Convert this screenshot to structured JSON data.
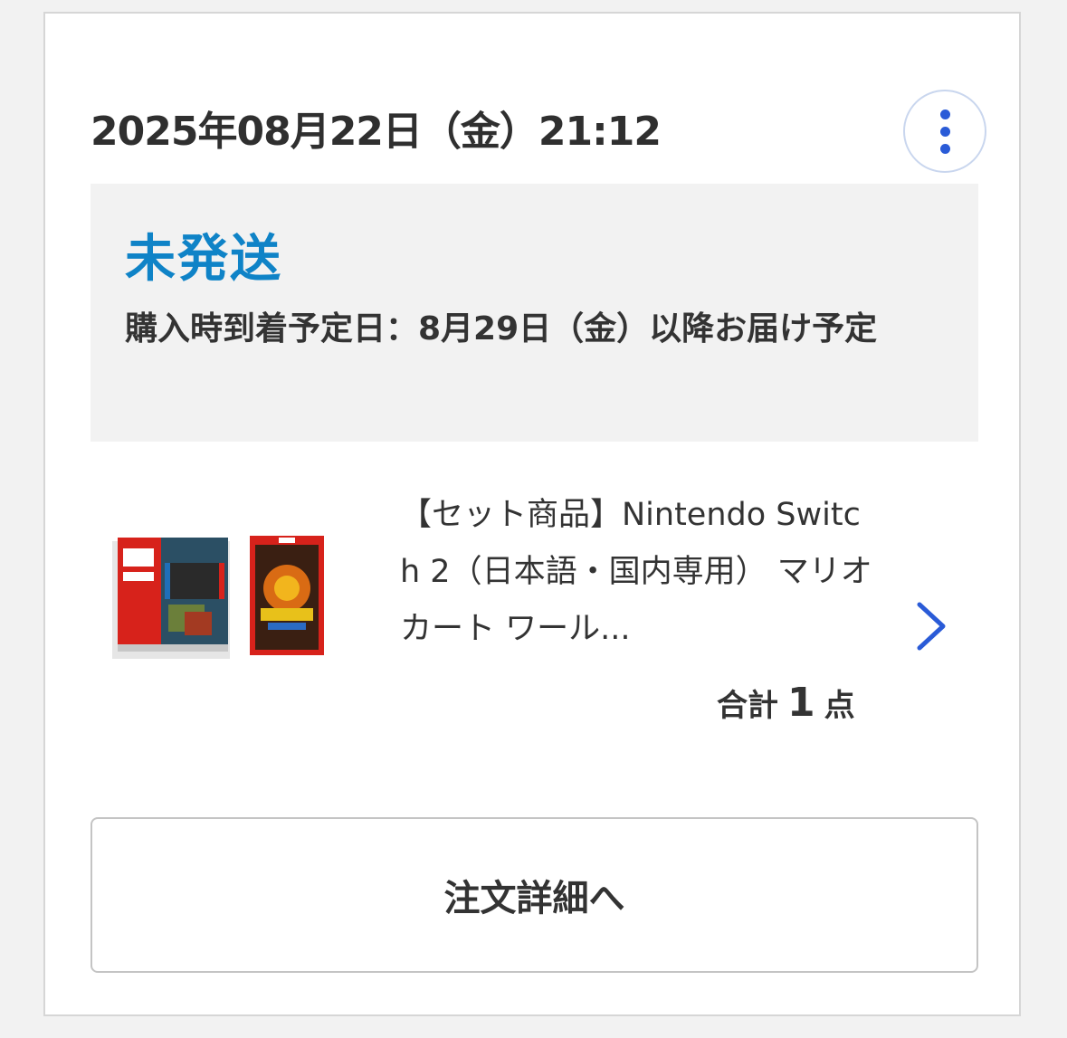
{
  "order": {
    "datetime": "2025年08月22日（金）21:12",
    "menu_icon": "more-vertical-icon"
  },
  "status": {
    "title": "未発送",
    "title_color": "#0f83c7",
    "delivery_text": "購入時到着予定日：8月29日（金）以降お届け予定"
  },
  "product": {
    "name": "【セット商品】Nintendo Switch 2（日本語・国内専用） マリオカート ワール...",
    "image_icon": "product-thumbnail",
    "chevron_icon": "chevron-right-icon"
  },
  "total": {
    "prefix": "合計",
    "count": "1",
    "suffix": "点"
  },
  "detail_button": {
    "label": "注文詳細へ"
  },
  "colors": {
    "accent": "#2a5bd7",
    "background": "#f2f2f2"
  }
}
